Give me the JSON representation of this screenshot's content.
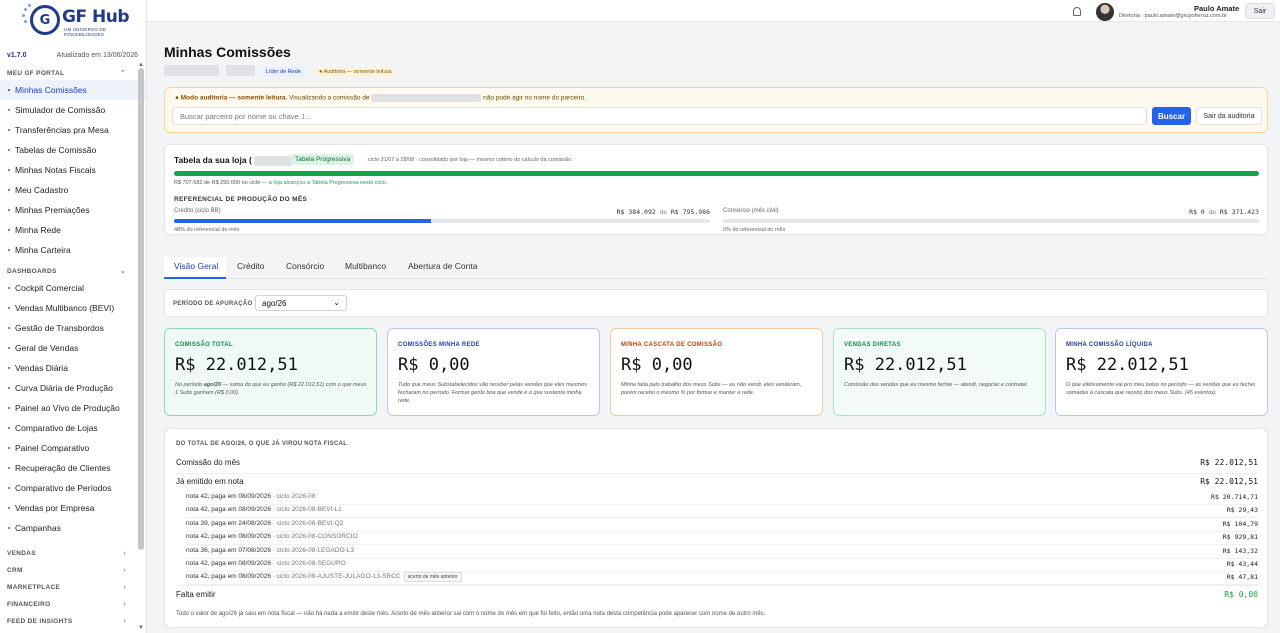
{
  "brand": {
    "name": "GF Hub",
    "mark": "G",
    "tagline": "UM UNIVERSO DE POSSIBILIDADES"
  },
  "version": "v1.7.0",
  "updated": "Atualizado em 13/06/2026",
  "sidebar": {
    "sections": [
      {
        "title": "MEU GF PORTAL",
        "chev": "⌃"
      },
      {
        "title": "DASHBOARDS",
        "chev": "⌄"
      },
      {
        "title": "VENDAS",
        "chev": "›"
      },
      {
        "title": "CRM",
        "chev": "›"
      },
      {
        "title": "MARKETPLACE",
        "chev": "›"
      },
      {
        "title": "FINANCEIRO",
        "chev": "›"
      },
      {
        "title": "FEED DE INSIGHTS",
        "chev": "›"
      }
    ],
    "portal_items": [
      "Minhas Comissões",
      "Simulador de Comissão",
      "Transferências pra Mesa",
      "Tabelas de Comissão",
      "Minhas Notas Fiscais",
      "Meu Cadastro",
      "Minhas Premiações",
      "Minha Rede",
      "Minha Carteira"
    ],
    "dashboard_items": [
      "Cockpit Comercial",
      "Vendas Multibanco (BEVI)",
      "Gestão de Transbordos",
      "Geral de Vendas",
      "Vendas Diária",
      "Curva Diária de Produção",
      "Painel ao Vivo de Produção",
      "Comparativo de Lojas",
      "Painel Comparativo",
      "Recuperação de Clientes",
      "Comparativo de Períodos",
      "Vendas por Empresa",
      "Campanhas"
    ]
  },
  "topbar": {
    "user_name": "Paulo Amate",
    "user_info": "Diretoria · paulo.amate@grupoferraz.com.br",
    "logout": "Sair"
  },
  "page": {
    "title": "Minhas Comissões",
    "badge_role": "Líder de Rede",
    "badge_audit": "● Auditoria — somente leitura"
  },
  "audit": {
    "bold": "● Modo auditoria — somente leitura.",
    "pre": " Visualizando a comissão de ",
    "post": " não pode agir no nome do parceiro.",
    "search_placeholder": "Buscar parceiro por nome ou chave J...",
    "search_btn": "Buscar",
    "exit_btn": "Sair da auditoria"
  },
  "progressive": {
    "title": "Tabela da sua loja (",
    "badge": "Tabela Progressiva",
    "cycle": "ciclo 31/07 a 28/08 · consolidado por loja — mesmo critério do cálculo da comissão",
    "fill": 1.0,
    "info": "R$ 707.682 de R$ 250.000 no ciclo",
    "info_ok": " — a loja alcançou a Tabela Progressiva neste ciclo.",
    "ref_title": "REFERENCIAL DE PRODUÇÃO DO MÊS",
    "credit": {
      "label": "Crédito (ciclo BB)",
      "value": "R$ 384.092",
      "de": "de",
      "total": "R$ 795.986",
      "fill": 0.48,
      "pct": "48% do referencial do mês"
    },
    "consorcio": {
      "label": "Consórcio (mês civil)",
      "value": "R$ 0",
      "de": "de",
      "total": "R$ 371.423",
      "fill": 0.0,
      "pct": "0% do referencial do mês"
    }
  },
  "tabs": [
    "Visão Geral",
    "Crédito",
    "Consórcio",
    "Multibanco",
    "Abertura de Conta"
  ],
  "period": {
    "label": "PERÍODO DE APURAÇÃO",
    "value": "ago/26",
    "chev": "⌄"
  },
  "kpis": [
    {
      "title": "COMISSÃO TOTAL",
      "value": "R$ 22.012,51",
      "desc_pre": "No período ",
      "desc_bold": "ago/26",
      "desc_post": " — soma do que eu ganho (R$ 22.012,51) com o que meus 1 Subs ganham (R$ 0,00).",
      "color": "#0f8a52",
      "bg": "#effaf4",
      "border": "#8fd8b3"
    },
    {
      "title": "COMISSÕES MINHA REDE",
      "value": "R$ 0,00",
      "desc_pre": "Tudo que meus Substabelecidos vão receber pelas vendas que eles mesmos fecharam no período. Formar gente boa que vende é o que sustenta minha rede.",
      "desc_bold": "",
      "desc_post": "",
      "color": "#1e40af",
      "bg": "#ffffff",
      "border": "#b7c8ee"
    },
    {
      "title": "MINHA CASCATA DE COMISSÃO",
      "value": "R$ 0,00",
      "desc_pre": "Minha fatia pelo trabalho dos meus Subs — eu não vendi, eles venderam, porém recebo o mesmo % por formar e manter a rede.",
      "desc_bold": "",
      "desc_post": "",
      "color": "#c2410c",
      "bg": "#ffffff",
      "border": "#f5c99a"
    },
    {
      "title": "VENDAS DIRETAS",
      "value": "R$ 22.012,51",
      "desc_pre": "Comissão das vendas que eu mesmo fechei — atendi, negociei e contratei.",
      "desc_bold": "",
      "desc_post": "",
      "color": "#0f8a52",
      "bg": "#f3fbf7",
      "border": "#a9e0c4"
    },
    {
      "title": "MINHA COMISSÃO LÍQUIDA",
      "value": "R$ 22.012,51",
      "desc_pre": "O que efetivamente vai pro meu bolso no período — as vendas que eu fechei somadas à cascata que recebo dos meus Subs. (45 eventos)",
      "desc_bold": "",
      "desc_post": "",
      "color": "#1e3a8a",
      "bg": "#ffffff",
      "border": "#b7c8ee"
    }
  ],
  "nf": {
    "title": "DO TOTAL DE AGO/26, O QUE JÁ VIROU NOTA FISCAL",
    "comissao_label": "Comissão do mês",
    "comissao_val": "R$ 22.012,51",
    "emitido_label": "Já emitido em nota",
    "emitido_val": "R$ 22.012,51",
    "notas": [
      {
        "text": "nota 42, paga em 08/09/2026",
        "cycle": " · ciclo 2026-08",
        "tag": "",
        "val": "R$ 20.714,71"
      },
      {
        "text": "nota 42, paga em 08/09/2026",
        "cycle": " · ciclo 2026-08-BEVI-L1",
        "tag": "",
        "val": "R$ 29,43"
      },
      {
        "text": "nota 39, paga em 24/08/2026",
        "cycle": " · ciclo 2026-08-BEVI-Q2",
        "tag": "",
        "val": "R$ 104,79"
      },
      {
        "text": "nota 42, paga em 08/09/2026",
        "cycle": " · ciclo 2026-08-CONSORCIO",
        "tag": "",
        "val": "R$ 929,81"
      },
      {
        "text": "nota 36, paga em 07/08/2026",
        "cycle": " · ciclo 2026-08-LEGADO-L3",
        "tag": "",
        "val": "R$ 143,32"
      },
      {
        "text": "nota 42, paga em 08/09/2026",
        "cycle": " · ciclo 2026-08-SEGURO",
        "tag": "",
        "val": "R$ 43,44"
      },
      {
        "text": "nota 42, paga em 08/09/2026",
        "cycle": " · ciclo 2026-09-AJUSTE-JULAGO-13-SRCC",
        "tag": "acerto de mês anterior",
        "val": "R$ 47,81"
      }
    ],
    "falta_label": "Falta emitir",
    "falta_val": "R$ 0,00",
    "footer": "Todo o valor de ago/26 já saiu em nota fiscal — não há nada a emitir deste mês. Acerto de mês anterior sai com o nome do mês em que foi feito, então uma nota desta competência pode aparecer com nome de outro mês."
  }
}
